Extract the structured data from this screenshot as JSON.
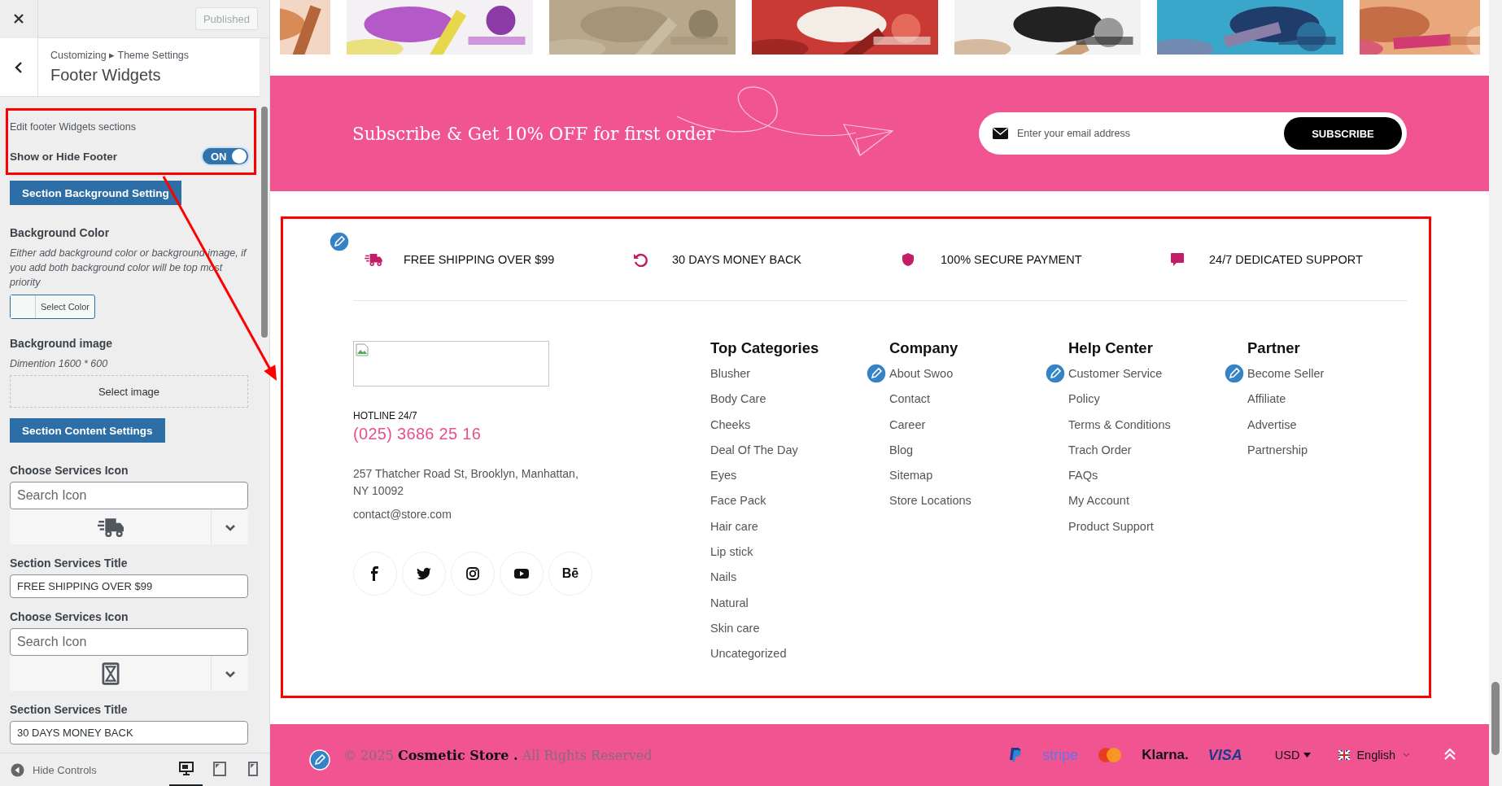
{
  "customizer": {
    "publish_button": {
      "label": "Published",
      "disabled": true
    },
    "breadcrumb": "Customizing ▸ Theme Settings",
    "title": "Footer Widgets",
    "controls": [
      {
        "kind": "description",
        "text": "Edit footer Widgets sections"
      },
      {
        "kind": "toggle",
        "label": "Show or Hide Footer",
        "on": true,
        "text": "ON"
      },
      {
        "kind": "section_button",
        "label": "Section Background Setting"
      },
      {
        "kind": "heading",
        "text": "Background Color"
      },
      {
        "kind": "note",
        "text": "Either add background color or background image, if you add both background color will be top most priority"
      },
      {
        "kind": "color_picker",
        "label": "Select Color"
      },
      {
        "kind": "heading",
        "text": "Background image"
      },
      {
        "kind": "note",
        "text": "Dimention 1600 * 600"
      },
      {
        "kind": "image_picker",
        "label": "Select image"
      },
      {
        "kind": "section_button",
        "label": "Section Content Settings"
      },
      {
        "kind": "heading",
        "text": "Choose Services Icon"
      },
      {
        "kind": "icon_picker",
        "placeholder": "Search Icon"
      },
      {
        "kind": "heading",
        "text": "Section Services Title"
      },
      {
        "kind": "text_input",
        "value": "FREE SHIPPING OVER $99"
      },
      {
        "kind": "heading",
        "text": "Choose Services Icon"
      },
      {
        "kind": "icon_picker",
        "placeholder": "Search Icon"
      },
      {
        "kind": "heading",
        "text": "Section Services Title"
      },
      {
        "kind": "text_input",
        "value": "30 DAYS MONEY BACK"
      }
    ],
    "hide_controls": "Hide Controls",
    "devices": [
      {
        "kind": "desktop",
        "selected": true
      },
      {
        "kind": "tablet",
        "selected": false
      },
      {
        "kind": "mobile",
        "selected": false
      }
    ]
  },
  "preview": {
    "subscribe": {
      "title": "Subscribe & Get 10% OFF for first order",
      "placeholder": "Enter your email address",
      "button": "SUBSCRIBE"
    },
    "services": [
      {
        "title": "FREE SHIPPING OVER $99"
      },
      {
        "title": "30 DAYS MONEY BACK"
      },
      {
        "title": "100% SECURE PAYMENT"
      },
      {
        "title": "24/7 DEDICATED SUPPORT"
      }
    ],
    "contact": {
      "hotline_label": "HOTLINE 24/7",
      "phone": "(025) 3686 25 16",
      "address": "257 Thatcher Road St, Brooklyn, Manhattan, NY 10092",
      "email": "contact@store.com"
    },
    "social": [
      {
        "kind": "mark"
      },
      {
        "kind": "mark"
      },
      {
        "kind": "mark"
      },
      {
        "kind": "mark"
      },
      {
        "kind": "wordmark",
        "text": "Bē"
      }
    ],
    "columns": [
      {
        "title": "Top Categories",
        "links": [
          "Blusher",
          "Body Care",
          "Cheeks",
          "Deal Of The Day",
          "Eyes",
          "Face Pack",
          "Hair care",
          "Lip stick",
          "Nails",
          "Natural",
          "Skin care",
          "Uncategorized"
        ]
      },
      {
        "title": "Company",
        "links": [
          "About Swoo",
          "Contact",
          "Career",
          "Blog",
          "Sitemap",
          "Store Locations"
        ]
      },
      {
        "title": "Help Center",
        "links": [
          "Customer Service",
          "Policy",
          "Terms & Conditions",
          "Trach Order",
          "FAQs",
          "My Account",
          "Product Support"
        ]
      },
      {
        "title": "Partner",
        "links": [
          "Become Seller",
          "Affiliate",
          "Advertise",
          "Partnership"
        ]
      }
    ],
    "footer_bar": {
      "copyright": "© 2025 **Cosmetic Store .** All Rights Reserved",
      "payments": [
        {
          "kind": "mark"
        },
        {
          "kind": "wordmark",
          "text": "stripe"
        },
        {
          "kind": "mark"
        },
        {
          "kind": "wordmark",
          "text": "Klarna."
        },
        {
          "kind": "wordmark",
          "text": "VISA"
        }
      ],
      "currency": "USD",
      "language": "English"
    }
  },
  "annotation": {
    "kind": "highlight"
  }
}
